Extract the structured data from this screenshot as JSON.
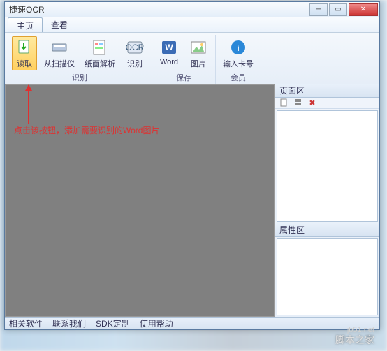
{
  "window": {
    "title": "捷速OCR"
  },
  "menu": {
    "items": [
      {
        "label": "主页",
        "active": true
      },
      {
        "label": "查看",
        "active": false
      }
    ]
  },
  "ribbon": {
    "groups": [
      {
        "label": "识别",
        "buttons": [
          {
            "id": "read",
            "label": "读取",
            "highlighted": true,
            "icon": "file-arrow"
          },
          {
            "id": "scanner",
            "label": "从扫描仪",
            "icon": "scanner"
          },
          {
            "id": "parse",
            "label": "纸面解析",
            "icon": "page-parse"
          },
          {
            "id": "ocr",
            "label": "识别",
            "icon": "ocr"
          }
        ]
      },
      {
        "label": "保存",
        "buttons": [
          {
            "id": "word",
            "label": "Word",
            "icon": "word"
          },
          {
            "id": "image",
            "label": "图片",
            "icon": "picture"
          }
        ]
      },
      {
        "label": "会员",
        "buttons": [
          {
            "id": "cardno",
            "label": "输入卡号",
            "icon": "info"
          }
        ]
      }
    ]
  },
  "annotation": {
    "text": "点击该按钮，添加需要识别的Word图片"
  },
  "side": {
    "pages": {
      "title": "页面区"
    },
    "props": {
      "title": "属性区"
    }
  },
  "status": {
    "items": [
      {
        "label": "相关软件"
      },
      {
        "label": "联系我们"
      },
      {
        "label": "SDK定制"
      },
      {
        "label": "使用帮助"
      }
    ]
  },
  "watermark": {
    "site": "脚本之家",
    "url": "jb51.net"
  }
}
